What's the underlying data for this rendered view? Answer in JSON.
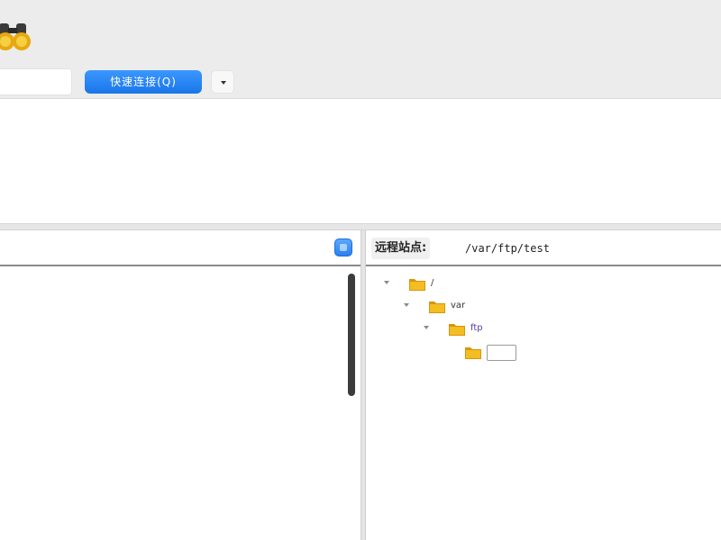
{
  "toolbar": {
    "icons": {
      "site_manager": "binoculars-icon"
    },
    "host_value": "",
    "quickconnect_label": "快速连接(Q)"
  },
  "remote": {
    "label": "远程站点:",
    "path": "/var/ftp/test"
  },
  "tree": [
    {
      "depth": 0,
      "label": "/",
      "expanded": true
    },
    {
      "depth": 1,
      "label": "var",
      "expanded": true
    },
    {
      "depth": 2,
      "label": "ftp",
      "expanded": true
    },
    {
      "depth": 3,
      "label": "",
      "editing": true
    }
  ],
  "colors": {
    "accent": "#1a76e8",
    "folder": "#f0b419",
    "toolbar_bg": "#ececec"
  }
}
